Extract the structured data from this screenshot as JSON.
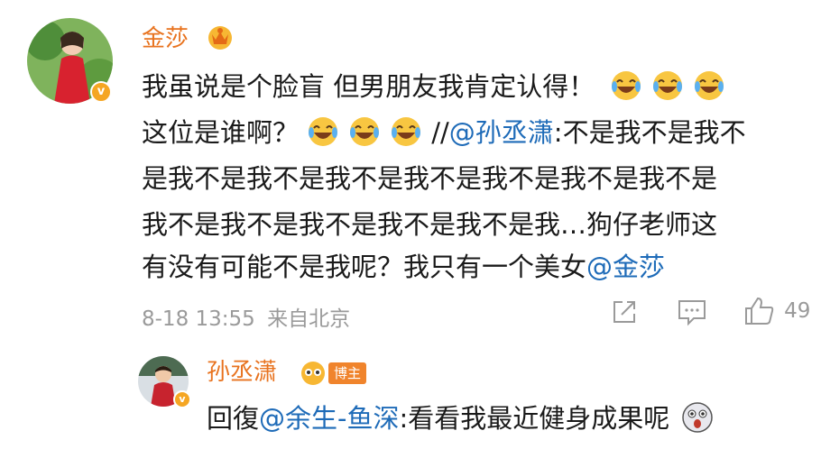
{
  "comment": {
    "username": "金莎",
    "line1": "我虽说是个脸盲 但男朋友我肯定认得！",
    "line2_prefix": "这位是谁啊？",
    "repost_sep": "//",
    "repost_user": "@孙丞潇",
    "repost_colon_start": ":不是我不是我不",
    "line3": "是我不是我不是我不是我不是我不是我不是我不是",
    "line4": "我不是我不是我不是我不是我不是我…狗仔老师这",
    "line5_prefix": "有没有可能不是我呢？我只有一个美女",
    "line5_mention": "@金莎",
    "time": "8-18 13:55",
    "source": "来自北京",
    "like_count": "49"
  },
  "reply": {
    "username": "孙丞潇",
    "badge_label": "博主",
    "reply_prefix": "回復",
    "reply_mention": "@余生-鱼深",
    "reply_text": ":看看我最近健身成果呢"
  },
  "icons": [
    "laugh-cry-emoji",
    "share-icon",
    "comment-icon",
    "like-icon",
    "verified-badge-icon",
    "crown-icon",
    "shock-emoji"
  ],
  "colors": {
    "username": "#e8731f",
    "mention": "#1e6bb8",
    "meta": "#9a9a9a",
    "badge": "#f0842c"
  }
}
